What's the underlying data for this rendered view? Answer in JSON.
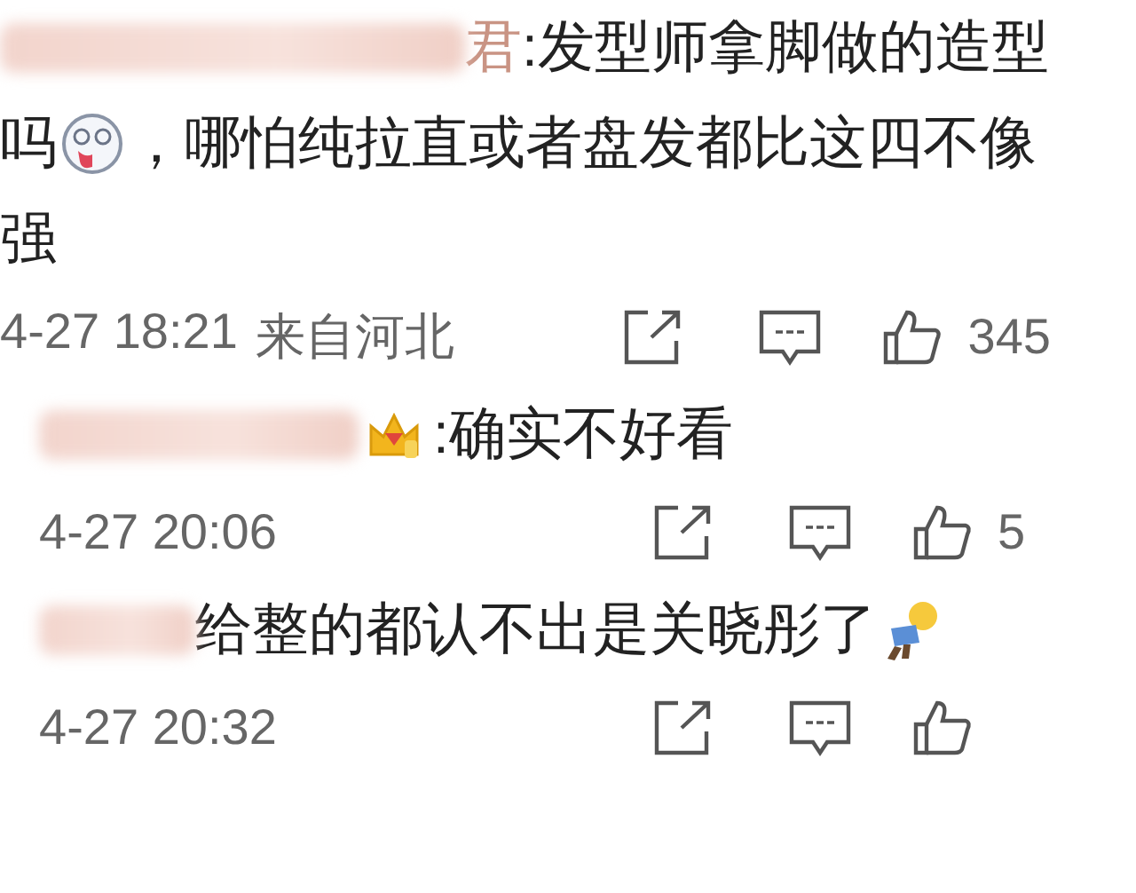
{
  "comments": [
    {
      "author": {
        "blurred": true,
        "visible_text": "君"
      },
      "indent": false,
      "lines": [
        [
          {
            "kind": "text",
            "text": ":发型师拿脚做的造型"
          }
        ],
        [
          {
            "kind": "text",
            "text": "吗"
          },
          {
            "kind": "face"
          },
          {
            "kind": "text",
            "text": "，哪怕纯拉直或者盘发都比这四不像"
          }
        ],
        [
          {
            "kind": "text",
            "text": "强"
          }
        ]
      ],
      "time": "4-27 18:21",
      "location": "来自河北",
      "likes": "345"
    },
    {
      "author": {
        "blurred": true,
        "crowned": true
      },
      "indent": true,
      "lines": [
        [
          {
            "kind": "text",
            "text": ":确实不好看"
          }
        ]
      ],
      "time": "4-27 20:06",
      "likes": "5"
    },
    {
      "author": {
        "blurred": true
      },
      "indent": true,
      "lines": [
        [
          {
            "kind": "text",
            "text": "给整的都认不出是关晓彤了"
          },
          {
            "kind": "figure"
          }
        ]
      ],
      "time": "4-27 20:32"
    }
  ]
}
